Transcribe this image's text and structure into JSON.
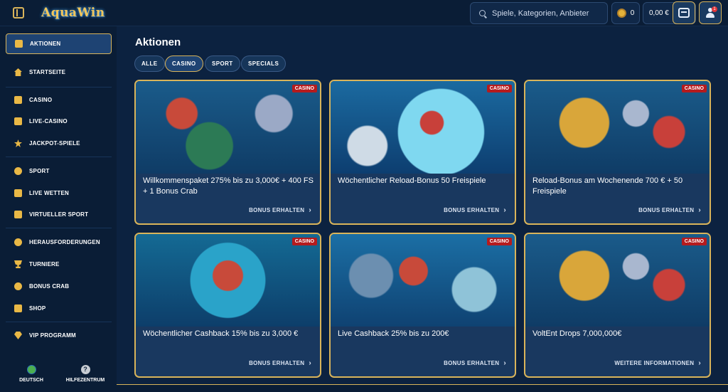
{
  "header": {
    "logo_text": "AquaWin",
    "search_placeholder": "Spiele, Kategorien, Anbieter",
    "coins_count": "0",
    "balance": "0,00 €",
    "notification_count": "1"
  },
  "sidebar": {
    "items": [
      {
        "label": "AKTIONEN",
        "icon": "gift-icon",
        "active": true
      },
      {
        "label": "STARTSEITE",
        "icon": "home-icon"
      },
      {
        "label": "CASINO",
        "icon": "slot-machine-icon"
      },
      {
        "label": "LIVE-CASINO",
        "icon": "cards-icon"
      },
      {
        "label": "JACKPOT-SPIELE",
        "icon": "clover-icon"
      },
      {
        "label": "SPORT",
        "icon": "ball-icon"
      },
      {
        "label": "LIVE WETTEN",
        "icon": "live-icon"
      },
      {
        "label": "VIRTUELLER SPORT",
        "icon": "monitor-icon"
      },
      {
        "label": "HERAUSFORDERUNGEN",
        "icon": "target-icon"
      },
      {
        "label": "TURNIERE",
        "icon": "trophy-icon"
      },
      {
        "label": "BONUS CRAB",
        "icon": "crab-icon"
      },
      {
        "label": "SHOP",
        "icon": "shop-icon"
      },
      {
        "label": "VIP PROGRAMM",
        "icon": "diamond-icon"
      }
    ],
    "footer": {
      "language_label": "DEUTSCH",
      "help_label": "HILFEZENTRUM"
    }
  },
  "main": {
    "title": "Aktionen",
    "tabs": [
      {
        "label": "ALLE",
        "active": false
      },
      {
        "label": "CASINO",
        "active": true
      },
      {
        "label": "SPORT",
        "active": false
      },
      {
        "label": "SPECIALS",
        "active": false
      }
    ],
    "cards": [
      {
        "badge": "CASINO",
        "title": "Willkommenspaket 275% bis zu 3,000€ + 400 FS + 1 Bonus Crab",
        "cta": "BONUS ERHALTEN"
      },
      {
        "badge": "CASINO",
        "title": "Wöchentlicher Reload-Bonus 50 Freispiele",
        "cta": "BONUS ERHALTEN"
      },
      {
        "badge": "CASINO",
        "title": "Reload-Bonus am Wochenende 700 € + 50 Freispiele",
        "cta": "BONUS ERHALTEN"
      },
      {
        "badge": "CASINO",
        "title": "Wöchentlicher Cashback 15% bis zu 3,000 €",
        "cta": "BONUS ERHALTEN"
      },
      {
        "badge": "CASINO",
        "title": "Live Cashback 25% bis zu 200€",
        "cta": "BONUS ERHALTEN"
      },
      {
        "badge": "CASINO",
        "title": "VoltEnt Drops 7,000,000€",
        "cta": "WEITERE INFORMATIONEN"
      }
    ]
  },
  "colors": {
    "background": "#0c2240",
    "accent_gold": "#d9b45a",
    "badge_red": "#b51b1e",
    "card_bg": "#19385f"
  }
}
